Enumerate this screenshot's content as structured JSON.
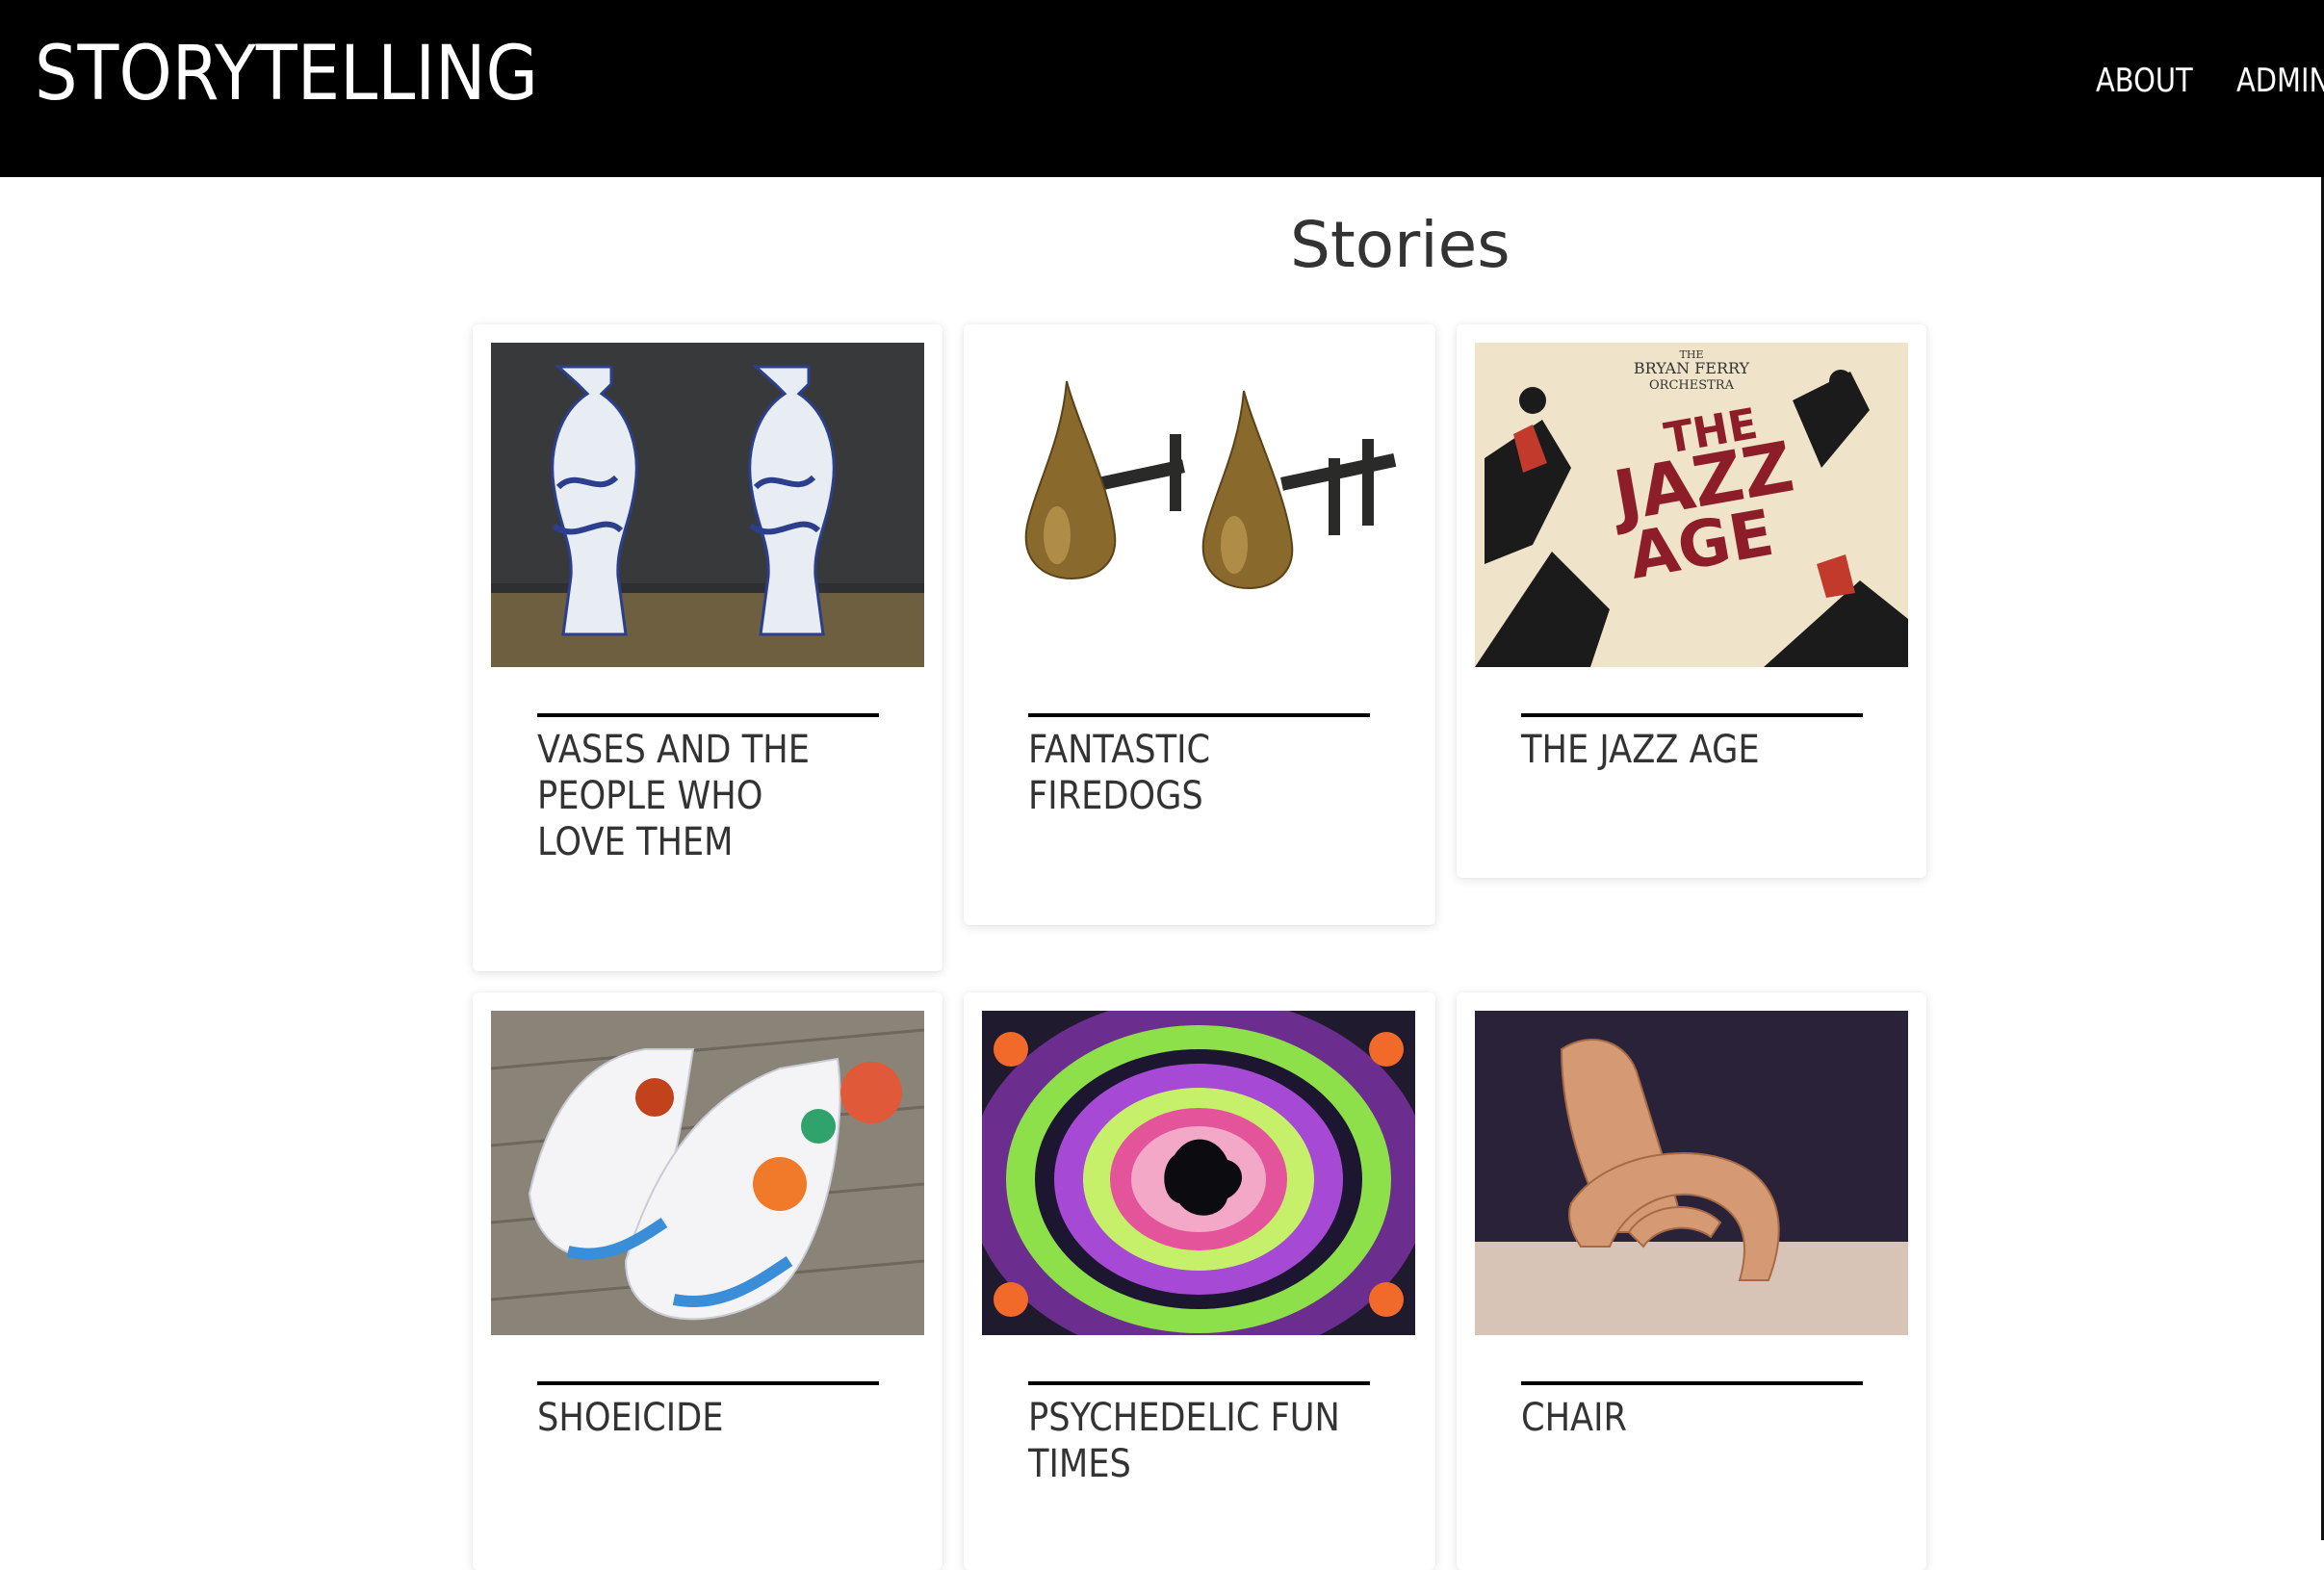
{
  "header": {
    "brand": "STORYTELLING",
    "nav": [
      {
        "label": "ABOUT"
      },
      {
        "label": "ADMIN"
      }
    ]
  },
  "main": {
    "title": "Stories",
    "stories": [
      {
        "title": "VASES AND THE PEOPLE WHO LOVE THEM",
        "image": "blue-white-vases-photo"
      },
      {
        "title": "FANTASTIC FIREDOGS",
        "image": "bronze-firedogs-photo"
      },
      {
        "title": "THE JAZZ AGE",
        "image": "jazz-age-album-cover",
        "image_text": {
          "line1": "THE",
          "line2": "BRYAN FERRY",
          "line3": "ORCHESTRA",
          "line4": "THE",
          "line5": "JAZZ",
          "line6": "AGE"
        }
      },
      {
        "title": "SHOEICIDE",
        "image": "painted-shoes-photo"
      },
      {
        "title": "PSYCHEDELIC FUN TIMES",
        "image": "fractal-art-image"
      },
      {
        "title": "CHAIR",
        "image": "cardboard-chair-photo"
      }
    ]
  },
  "colors": {
    "header_bg": "#000000",
    "accent_rule": "#000000",
    "text": "#333333"
  }
}
